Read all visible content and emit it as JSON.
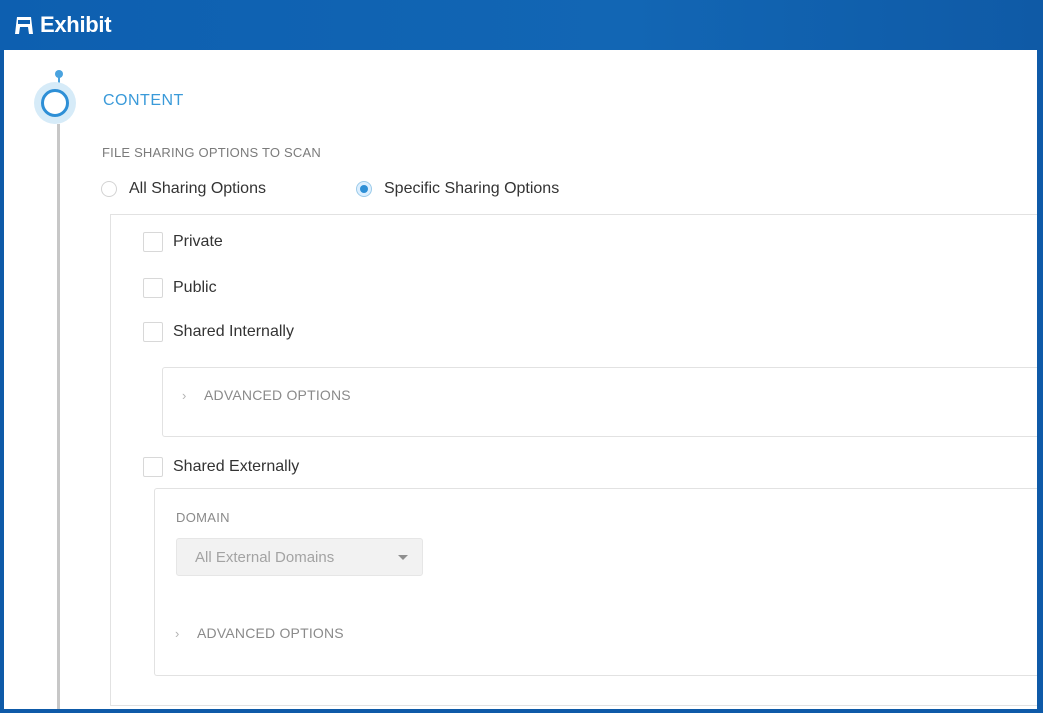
{
  "app": {
    "title": "Exhibit",
    "logo_icon": "exhibit-logo-icon"
  },
  "colors": {
    "titlebar": "#0d5fb0",
    "accent": "#2e8fd6",
    "section_title": "#3a9ad9"
  },
  "content": {
    "section_title": "CONTENT",
    "file_sharing_label": "FILE SHARING OPTIONS TO SCAN",
    "scan_scope": {
      "selected": "Specific Sharing Options",
      "options": [
        {
          "label": "All Sharing Options",
          "checked": false
        },
        {
          "label": "Specific Sharing Options",
          "checked": true
        }
      ]
    },
    "sharing_options": [
      {
        "label": "Private",
        "checked": false
      },
      {
        "label": "Public",
        "checked": false
      },
      {
        "label": "Shared Internally",
        "checked": false
      },
      {
        "label": "Shared Externally",
        "checked": false
      }
    ],
    "internal_advanced_label": "ADVANCED OPTIONS",
    "external": {
      "domain_label": "DOMAIN",
      "domain_value": "All External Domains",
      "advanced_label": "ADVANCED OPTIONS"
    }
  }
}
